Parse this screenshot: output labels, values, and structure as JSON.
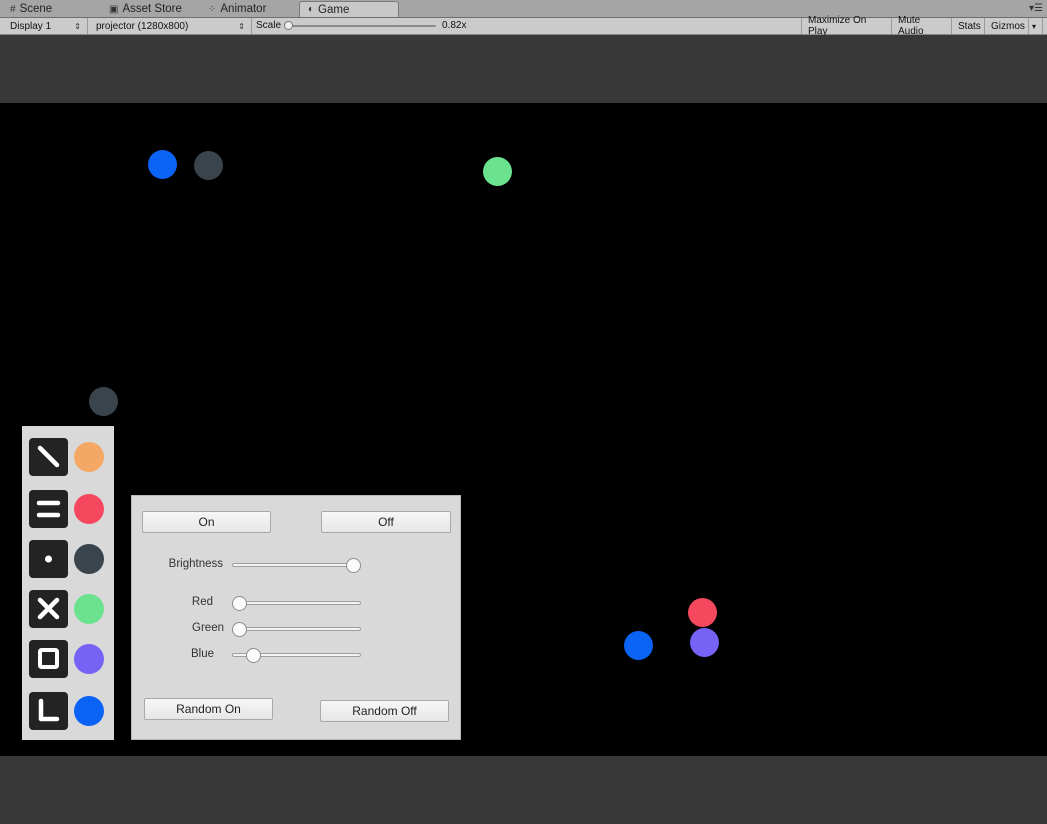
{
  "tabs": [
    {
      "label": "Scene",
      "icon": "grid-icon"
    },
    {
      "label": "Asset Store",
      "icon": "store-icon"
    },
    {
      "label": "Animator",
      "icon": "animator-icon"
    },
    {
      "label": "Game",
      "icon": "game-icon",
      "active": true
    }
  ],
  "toolbar": {
    "display": "Display 1",
    "resolution": "projector (1280x800)",
    "scale_label": "Scale",
    "scale_value": "0.82x",
    "scale_fraction": 0.0,
    "maximize": "Maximize On Play",
    "mute": "Mute Audio",
    "stats": "Stats",
    "gizmos": "Gizmos"
  },
  "scene_dots": [
    {
      "color": "#0a63f5"
    },
    {
      "color": "#3a444c"
    },
    {
      "color": "#6be38e"
    },
    {
      "color": "#3a444c"
    },
    {
      "color": "#f5485f"
    },
    {
      "color": "#0a63f5"
    },
    {
      "color": "#7662f5"
    }
  ],
  "palette": [
    {
      "tool": "line-tool-icon",
      "color": "#f5a865"
    },
    {
      "tool": "double-line-tool-icon",
      "color": "#f5485f"
    },
    {
      "tool": "point-tool-icon",
      "color": "#3a444c"
    },
    {
      "tool": "cross-tool-icon",
      "color": "#6be38e"
    },
    {
      "tool": "square-tool-icon",
      "color": "#7662f5"
    },
    {
      "tool": "corner-tool-icon",
      "color": "#0a63f5"
    }
  ],
  "panel": {
    "on_label": "On",
    "off_label": "Off",
    "brightness_label": "Brightness",
    "brightness_value": 1.0,
    "red_label": "Red",
    "red_value": 0.0,
    "green_label": "Green",
    "green_value": 0.0,
    "blue_label": "Blue",
    "blue_value": 0.12,
    "random_on_label": "Random On",
    "random_off_label": "Random Off"
  }
}
